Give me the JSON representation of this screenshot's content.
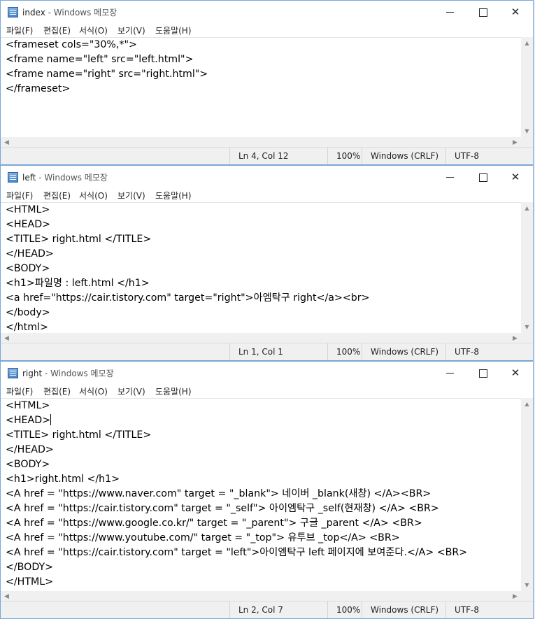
{
  "menu": {
    "file": "파일(F)",
    "edit": "편집(E)",
    "format": "서식(O)",
    "view": "보기(V)",
    "help": "도움말(H)"
  },
  "icons": {
    "app": "notepad-icon",
    "minimize": "minimize-icon",
    "maximize": "maximize-icon",
    "close": "close-icon"
  },
  "windows": [
    {
      "doc": "index",
      "app_suffix": " - Windows 메모장",
      "lines": [
        "<frameset cols=\"30%,*\">",
        "<frame name=\"left\" src=\"left.html\">",
        "<frame name=\"right\" src=\"right.html\">",
        "</frameset>"
      ],
      "status": {
        "position": "Ln 4, Col 12",
        "zoom": "100%",
        "eol": "Windows (CRLF)",
        "encoding": "UTF-8"
      }
    },
    {
      "doc": "left",
      "app_suffix": " - Windows 메모장",
      "lines": [
        "<HTML>",
        "<HEAD>",
        "<TITLE> right.html </TITLE>",
        "</HEAD>",
        "<BODY>",
        "<h1>파일명 : left.html </h1>",
        "<a href=\"https://cair.tistory.com\" target=\"right\">아엠탁구 right</a><br>",
        "</body>",
        "</html>"
      ],
      "status": {
        "position": "Ln 1, Col 1",
        "zoom": "100%",
        "eol": "Windows (CRLF)",
        "encoding": "UTF-8"
      }
    },
    {
      "doc": "right",
      "app_suffix": " - Windows 메모장",
      "lines": [
        "<HTML>",
        "<HEAD>",
        "<TITLE> right.html </TITLE>",
        "</HEAD>",
        "<BODY>",
        "<h1>right.html </h1>",
        "<A href = \"https://www.naver.com\" target = \"_blank\"> 네이버 _blank(새창) </A><BR>",
        "<A href = \"https://cair.tistory.com\" target = \"_self\"> 아이엠탁구 _self(현재창) </A> <BR>",
        "<A href = \"https://www.google.co.kr/\" target = \"_parent\"> 구글 _parent </A> <BR>",
        "<A href = \"https://www.youtube.com/\" target = \"_top\"> 유투브 _top</A> <BR>",
        "<A href = \"https://cair.tistory.com\" target = \"left\">아이엠탁구 left 페이지에 보여준다.</A> <BR>",
        "</BODY>",
        "</HTML>"
      ],
      "status": {
        "position": "Ln 2, Col 7",
        "zoom": "100%",
        "eol": "Windows (CRLF)",
        "encoding": "UTF-8"
      }
    }
  ]
}
